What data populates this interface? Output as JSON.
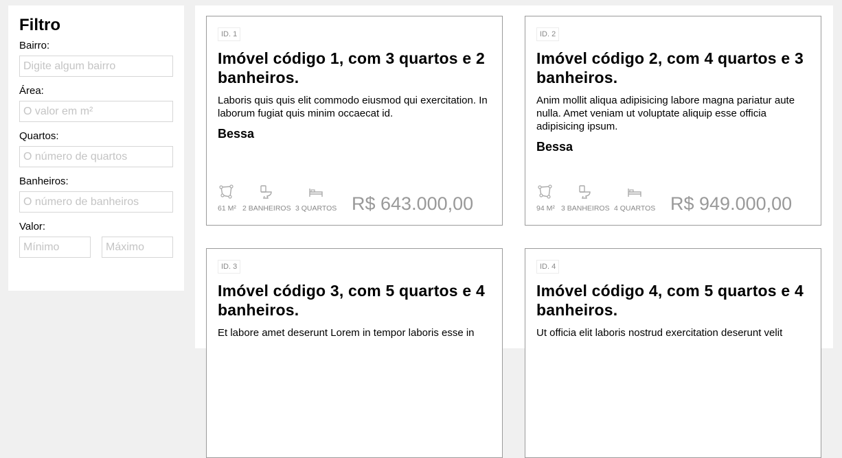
{
  "filter": {
    "title": "Filtro",
    "fields": {
      "bairro": {
        "label": "Bairro:",
        "placeholder": "Digite algum bairro"
      },
      "area": {
        "label": "Área:",
        "placeholder": "O valor em m²"
      },
      "quartos": {
        "label": "Quartos:",
        "placeholder": "O número de quartos"
      },
      "banheiros": {
        "label": "Banheiros:",
        "placeholder": "O número de banheiros"
      },
      "valor": {
        "label": "Valor:",
        "min_placeholder": "Mínimo",
        "max_placeholder": "Máximo"
      }
    }
  },
  "cards": [
    {
      "id": "ID. 1",
      "title": "Imóvel código 1, com 3 quartos e 2 banheiros.",
      "description": "Laboris quis quis elit commodo eiusmod qui exercitation. In laborum fugiat quis minim occaecat id.",
      "neighborhood": "Bessa",
      "area": "61 M²",
      "bathrooms": "2 BANHEIROS",
      "bedrooms": "3 QUARTOS",
      "price": "R$ 643.000,00"
    },
    {
      "id": "ID. 2",
      "title": "Imóvel código 2, com 4 quartos e 3 banheiros.",
      "description": "Anim mollit aliqua adipisicing labore magna pariatur aute nulla. Amet veniam ut voluptate aliquip esse officia adipisicing ipsum.",
      "neighborhood": "Bessa",
      "area": "94 M²",
      "bathrooms": "3 BANHEIROS",
      "bedrooms": "4 QUARTOS",
      "price": "R$ 949.000,00"
    },
    {
      "id": "ID. 3",
      "title": "Imóvel código 3, com 5 quartos e 4 banheiros.",
      "description": "Et labore amet deserunt Lorem in tempor laboris esse in"
    },
    {
      "id": "ID. 4",
      "title": "Imóvel código 4, com 5 quartos e 4 banheiros.",
      "description": "Ut officia elit laboris nostrud exercitation deserunt velit"
    }
  ]
}
